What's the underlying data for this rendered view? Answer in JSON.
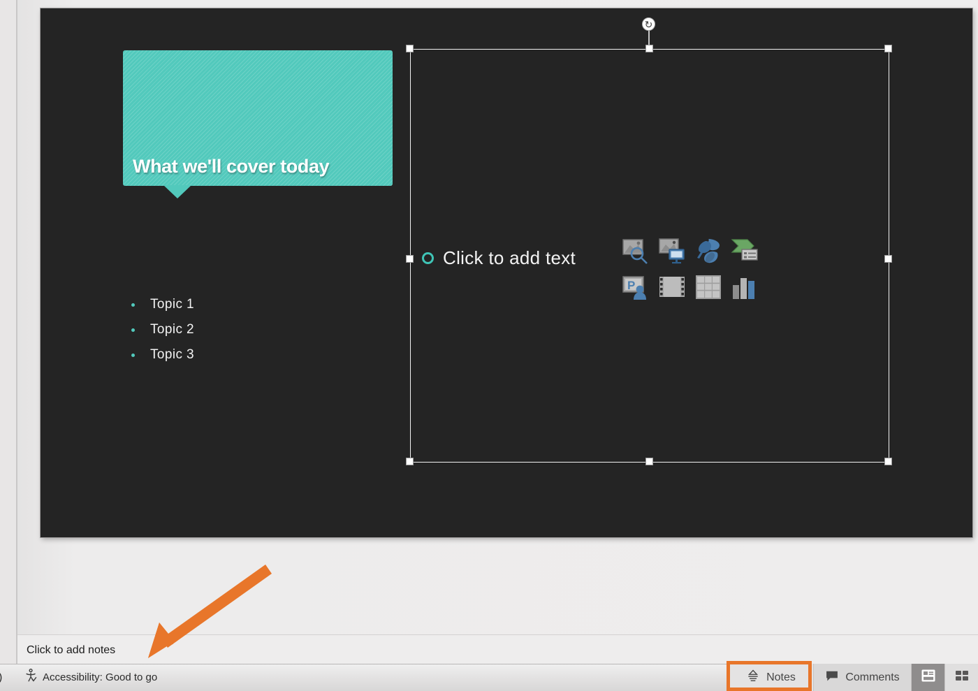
{
  "slide": {
    "title": "What we'll cover today",
    "bullets": [
      {
        "text": "Topic 1"
      },
      {
        "text": "Topic 2"
      },
      {
        "text": "Topic 3"
      }
    ],
    "content_placeholder": {
      "prompt": "Click to add text",
      "icons": [
        {
          "name": "pictures-icon",
          "label": "Pictures"
        },
        {
          "name": "stock-images-icon",
          "label": "Stock Images"
        },
        {
          "name": "icons-icon",
          "label": "Icons"
        },
        {
          "name": "smartart-icon",
          "label": "SmartArt"
        },
        {
          "name": "slide-from-outline-icon",
          "label": "Slides from Outline"
        },
        {
          "name": "video-icon",
          "label": "Video"
        },
        {
          "name": "table-icon",
          "label": "Table"
        },
        {
          "name": "chart-icon",
          "label": "Chart"
        }
      ],
      "selected": true,
      "rotate_handle_glyph": "↻"
    },
    "theme": {
      "background": "#242424",
      "accent_teal": "#52c9bc",
      "title_text": "#ffffff",
      "body_text": "#f2f2f2"
    }
  },
  "notes_pane": {
    "placeholder": "Click to add notes"
  },
  "annotation": {
    "arrow_color": "#e8762a",
    "highlight_color": "#e8762a",
    "highlight_target": "Notes"
  },
  "status_bar": {
    "truncated_left_text": ")",
    "accessibility": {
      "icon": "accessibility-icon",
      "label": "Accessibility: Good to go"
    },
    "notes": {
      "icon": "notes-icon",
      "label": "Notes"
    },
    "comments": {
      "icon": "comment-bubble-icon",
      "label": "Comments"
    },
    "views": [
      {
        "name": "normal-view-icon",
        "label": "Normal View",
        "active": true
      },
      {
        "name": "slide-sorter-view-icon",
        "label": "Slide Sorter View",
        "active": false
      }
    ]
  }
}
